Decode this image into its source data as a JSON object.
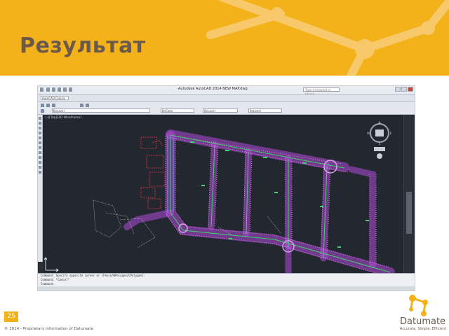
{
  "slide": {
    "title": "Результат",
    "page_number": "25",
    "copyright": "© 2014 - Proprietary information of Datumate"
  },
  "autocad": {
    "window_title": "Autodesk AutoCAD 2014    NEW MAP.dwg",
    "search_placeholder": "Type a keyword or phrase",
    "drawing_tab": "AutoCAD Classic",
    "layer_dropdown": "ByLayer",
    "linetype_dropdown": "ByLayer",
    "lineweight_dropdown": "ByLayer",
    "color_dropdown": "ByColor",
    "viewport_label": "[-][Top][2D Wireframe]",
    "command_history": [
      "Command:  Specify opposite corner  or  [Fence/WPolygon/CPolygon]:",
      "Command:  *Cancel*"
    ],
    "command_prompt": "Command:"
  },
  "logo": {
    "name": "Datumate",
    "tagline": "Accurate, Simple, Efficient"
  },
  "colors": {
    "brand_orange": "#f3b21a",
    "title_brown": "#6b5a4a",
    "cad_background": "#232830",
    "road_magenta": "#b14bd8",
    "centerline_green": "#3fd46a",
    "feature_red": "#d83a3a"
  }
}
